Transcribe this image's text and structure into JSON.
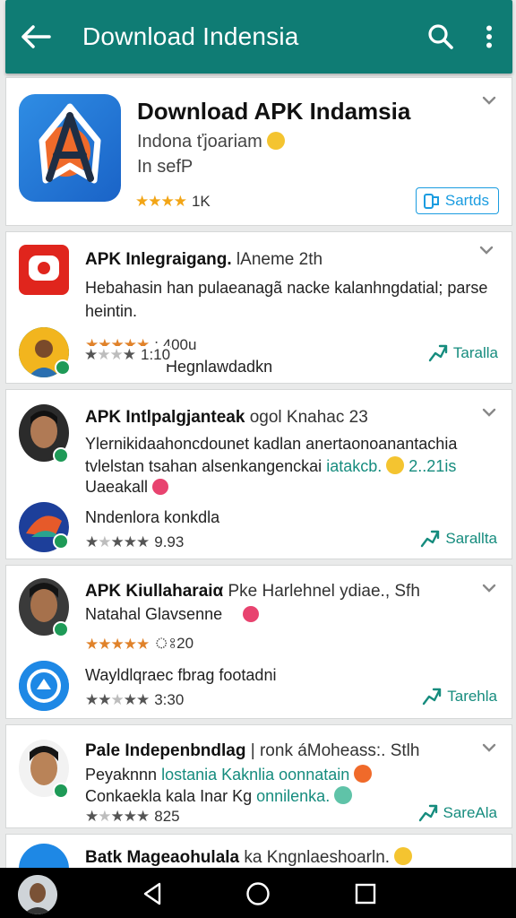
{
  "appbar": {
    "title": "Download Indensia",
    "back_icon": "arrow-left-icon",
    "search_icon": "search-icon",
    "more_icon": "more-vert-icon"
  },
  "hero": {
    "title": "Download APK Indamsia",
    "subtitle1": "Indona ťjoariam",
    "subtitle2": "In sefP",
    "rating_count": "1K",
    "button_label": "Sartds"
  },
  "posts": [
    {
      "title": "APK Inlegraigang.",
      "title_meta": "lAneme 2th",
      "line1": "Hebahasin han pulaeanagã nacke kalanhngdatial; parse",
      "line2": "heintin.",
      "rating": ": 400u",
      "teal_line": "Hegnlawdadkn",
      "rating2": "1:10",
      "share_label": "Taralla"
    },
    {
      "title": "APK Intlpalgjanteak",
      "title_meta": "ogol Knahac 23",
      "line1": "Ylernikidaahoncdounet kadlan anertaonoanantachia",
      "line2_a": "tvlelstan tsahan alsenkangenckai",
      "line2_b": "iatakcb.",
      "line2_c": "2..21is",
      "line3": "Uaeakall",
      "teal_line": "Nndenlora konkdla",
      "rating": "9.93",
      "share_label": "Sarallta"
    },
    {
      "title": "APK Kiullaharaiα",
      "title_meta": "Pke Harlehnel ydiae., Sfh",
      "line2": "Natahal Glavsenne",
      "rating": "ঃ20",
      "teal_line": "Wayldlqraec fbrag footadni",
      "rating2": "3:30",
      "share_label": "Tarehla"
    },
    {
      "title": "Pale Indepenbndlag",
      "title_meta": "| ronk áMoheass:. Stlh",
      "line1_a": "Peyaknnn",
      "line1_b": "lostania Kaknlia oonnatain",
      "line2_a": "Conkaekla kala Inar Kg",
      "line2_b": "onnilenka.",
      "rating": "825",
      "share_label": "SareAla"
    },
    {
      "title": "Batk Mageaohulala",
      "title_meta": "ka Kngnlaeshoarln."
    }
  ],
  "navbar": {
    "back_icon": "nav-back-icon",
    "home_icon": "nav-home-icon",
    "recents_icon": "nav-recents-icon"
  },
  "colors": {
    "appbar": "#0f7c74",
    "accent_teal": "#168c7e",
    "star": "#f2a516",
    "button_blue": "#1a9ce0"
  }
}
